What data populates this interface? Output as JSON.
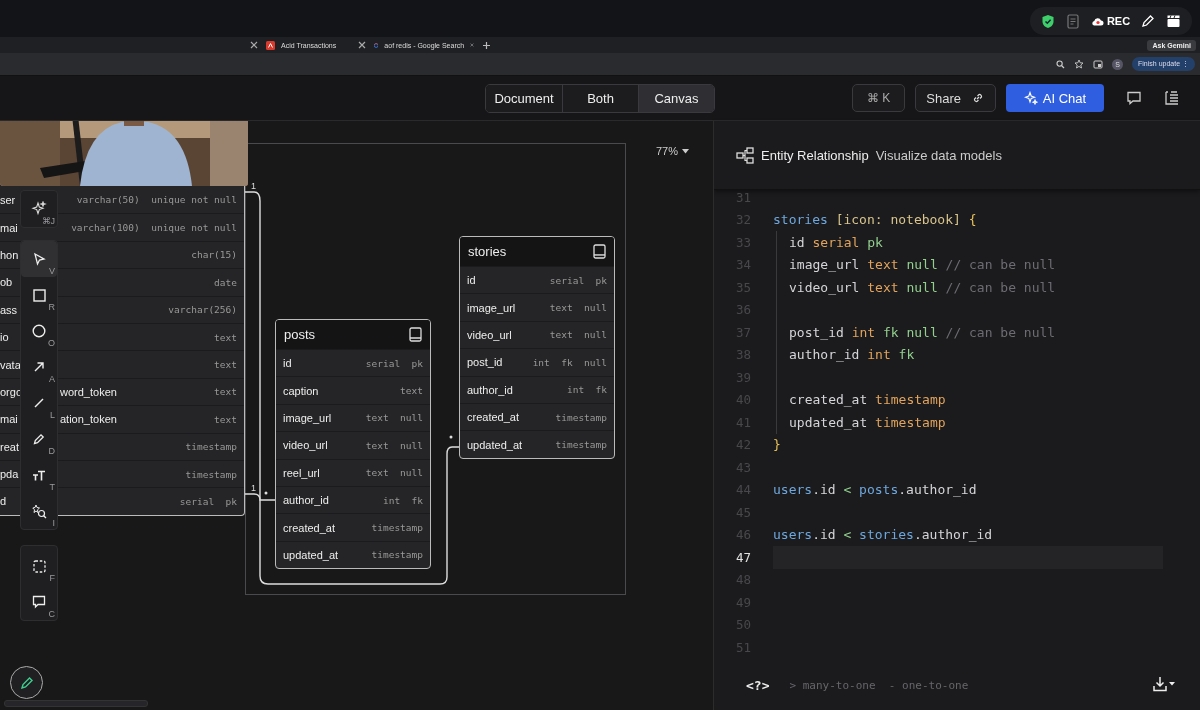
{
  "browser": {
    "tabs": [
      {
        "label": "Acid Transactions",
        "kind": "pdf"
      },
      {
        "label": "aof redis - Google Search",
        "kind": "google"
      }
    ],
    "gemini_button": "Ask Gemini",
    "profile": "S",
    "update_button": "Finish update",
    "update_menu": "⋮"
  },
  "recorder": {
    "label": "REC"
  },
  "header": {
    "views": [
      {
        "label": "Document",
        "selected": false
      },
      {
        "label": "Both",
        "selected": false
      },
      {
        "label": "Canvas",
        "selected": true
      }
    ],
    "shortcut": "⌘ K",
    "share": "Share",
    "ai_chat": "AI Chat"
  },
  "canvas": {
    "zoom": "77%",
    "cardinality": [
      "1",
      "1"
    ],
    "tool_groups": [
      [
        {
          "kind": "sparkle",
          "key": "⌘J",
          "selected": false
        }
      ],
      [
        {
          "kind": "select",
          "key": "V",
          "selected": true
        },
        {
          "kind": "rect",
          "key": "R",
          "selected": false
        },
        {
          "kind": "circle",
          "key": "O",
          "selected": false
        },
        {
          "kind": "arrow",
          "key": "A",
          "selected": false
        },
        {
          "kind": "line",
          "key": "L",
          "selected": false
        },
        {
          "kind": "pencil",
          "key": "D",
          "selected": false
        },
        {
          "kind": "text",
          "key": "T",
          "selected": false
        },
        {
          "kind": "shapes",
          "key": "I",
          "selected": false
        }
      ],
      [
        {
          "kind": "frame",
          "key": "F",
          "selected": false
        },
        {
          "kind": "comment",
          "key": "C",
          "selected": false
        }
      ]
    ],
    "users_rows": [
      {
        "name_start": "ser",
        "type": "varchar(50)  unique not null"
      },
      {
        "name_start": "mai",
        "type": "varchar(100)  unique not null"
      },
      {
        "name_start": "hon",
        "type": "char(15)"
      },
      {
        "name_start": "ob",
        "type": "date"
      },
      {
        "name_start": "ass",
        "type": "varchar(256)"
      },
      {
        "name_start": "io",
        "type": "text"
      },
      {
        "name_start": "vata",
        "type": "text"
      },
      {
        "name_start": "orgo",
        "name_end": "word_token",
        "type": "text"
      },
      {
        "name_start": "mai",
        "name_end": "ation_token",
        "type": "text"
      },
      {
        "name_start": "reat",
        "type": "timestamp"
      },
      {
        "name_start": "pda",
        "type": "timestamp"
      },
      {
        "name_start": "d",
        "type": "serial  pk"
      }
    ],
    "tables": [
      {
        "name": "posts",
        "rows": [
          {
            "name": "id",
            "type": "serial  pk"
          },
          {
            "name": "caption",
            "type": "text"
          },
          {
            "name": "image_url",
            "type": "text  null"
          },
          {
            "name": "video_url",
            "type": "text  null"
          },
          {
            "name": "reel_url",
            "type": "text  null"
          },
          {
            "name": "author_id",
            "type": "int  fk"
          },
          {
            "name": "created_at",
            "type": "timestamp"
          },
          {
            "name": "updated_at",
            "type": "timestamp"
          }
        ]
      },
      {
        "name": "stories",
        "rows": [
          {
            "name": "id",
            "type": "serial  pk"
          },
          {
            "name": "image_url",
            "type": "text  null"
          },
          {
            "name": "video_url",
            "type": "text  null"
          },
          {
            "name": "post_id",
            "type": "int  fk  null"
          },
          {
            "name": "author_id",
            "type": "int  fk"
          },
          {
            "name": "created_at",
            "type": "timestamp"
          },
          {
            "name": "updated_at",
            "type": "timestamp"
          }
        ]
      }
    ]
  },
  "editor": {
    "title": "Entity Relationship",
    "subtitle": "Visualize data models",
    "lines": [
      {
        "number": "31",
        "indent": false,
        "active": false
      },
      {
        "number": "32",
        "indent": false,
        "active": false,
        "tokens": [
          {
            "text": "stories ",
            "kind": "entity"
          },
          {
            "text": "[icon: notebook] ",
            "kind": "attr"
          },
          {
            "text": "{",
            "kind": "bracket"
          }
        ]
      },
      {
        "number": "33",
        "indent": true,
        "active": false,
        "tokens": [
          {
            "text": "id ",
            "kind": "field"
          },
          {
            "text": "serial ",
            "kind": "type"
          },
          {
            "text": "pk",
            "kind": "key"
          }
        ]
      },
      {
        "number": "34",
        "indent": true,
        "active": false,
        "tokens": [
          {
            "text": "image_url ",
            "kind": "field"
          },
          {
            "text": "text ",
            "kind": "type"
          },
          {
            "text": "null ",
            "kind": "key"
          },
          {
            "text": "// can be null",
            "kind": "comment"
          }
        ]
      },
      {
        "number": "35",
        "indent": true,
        "active": false,
        "tokens": [
          {
            "text": "video_url ",
            "kind": "field"
          },
          {
            "text": "text ",
            "kind": "type"
          },
          {
            "text": "null ",
            "kind": "key"
          },
          {
            "text": "// can be null",
            "kind": "comment"
          }
        ]
      },
      {
        "number": "36",
        "indent": true,
        "active": false
      },
      {
        "number": "37",
        "indent": true,
        "active": false,
        "tokens": [
          {
            "text": "post_id ",
            "kind": "field"
          },
          {
            "text": "int ",
            "kind": "type"
          },
          {
            "text": "fk null ",
            "kind": "key"
          },
          {
            "text": "// can be null",
            "kind": "comment"
          }
        ]
      },
      {
        "number": "38",
        "indent": true,
        "active": false,
        "tokens": [
          {
            "text": "author_id ",
            "kind": "field"
          },
          {
            "text": "int ",
            "kind": "type"
          },
          {
            "text": "fk",
            "kind": "key"
          }
        ]
      },
      {
        "number": "39",
        "indent": true,
        "active": false
      },
      {
        "number": "40",
        "indent": true,
        "active": false,
        "tokens": [
          {
            "text": "created_at ",
            "kind": "field"
          },
          {
            "text": "timestamp",
            "kind": "type"
          }
        ]
      },
      {
        "number": "41",
        "indent": true,
        "active": false,
        "tokens": [
          {
            "text": "updated_at ",
            "kind": "field"
          },
          {
            "text": "timestamp",
            "kind": "type"
          }
        ]
      },
      {
        "number": "42",
        "indent": false,
        "active": false,
        "tokens": [
          {
            "text": "}",
            "kind": "bracket"
          }
        ]
      },
      {
        "number": "43",
        "indent": false,
        "active": false
      },
      {
        "number": "44",
        "indent": false,
        "active": false,
        "tokens": [
          {
            "text": "users",
            "kind": "entity"
          },
          {
            "text": ".id ",
            "kind": "field"
          },
          {
            "text": "< ",
            "kind": "op"
          },
          {
            "text": "posts",
            "kind": "entity"
          },
          {
            "text": ".author_id",
            "kind": "field"
          }
        ]
      },
      {
        "number": "45",
        "indent": false,
        "active": false
      },
      {
        "number": "46",
        "indent": false,
        "active": false,
        "tokens": [
          {
            "text": "users",
            "kind": "entity"
          },
          {
            "text": ".id ",
            "kind": "field"
          },
          {
            "text": "< ",
            "kind": "op"
          },
          {
            "text": "stories",
            "kind": "entity"
          },
          {
            "text": ".author_id",
            "kind": "field"
          }
        ]
      },
      {
        "number": "47",
        "indent": false,
        "active": true
      },
      {
        "number": "48",
        "indent": false,
        "active": false
      },
      {
        "number": "49",
        "indent": false,
        "active": false
      },
      {
        "number": "50",
        "indent": false,
        "active": false
      },
      {
        "number": "51",
        "indent": false,
        "active": false
      }
    ],
    "help": "<?>",
    "hint": "> many-to-one  - one-to-one"
  }
}
